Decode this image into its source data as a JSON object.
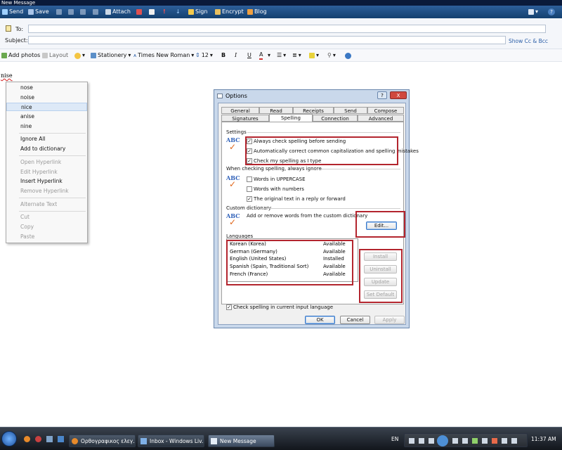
{
  "window": {
    "title": "New Message"
  },
  "toolbar": {
    "send": "Send",
    "save": "Save",
    "attach": "Attach",
    "sign": "Sign",
    "encrypt": "Encrypt",
    "blog": "Blog",
    "help": "?"
  },
  "header": {
    "to_label": "To:",
    "subject_label": "Subject:",
    "show_cc_bcc": "Show Cc & Bcc"
  },
  "format_bar": {
    "add_photos": "Add photos",
    "layout": "Layout",
    "stationery": "Stationery",
    "font": "Times New Roman",
    "size": "12",
    "bold": "B",
    "italic": "I",
    "underline": "U",
    "font_color": "A"
  },
  "body": {
    "misspelled_word": "nise"
  },
  "context_menu": {
    "suggestions": [
      "nose",
      "noise",
      "nice",
      "anise",
      "nine"
    ],
    "ignore_all": "Ignore All",
    "add_to_dictionary": "Add to dictionary",
    "open_hyperlink": "Open Hyperlink",
    "edit_hyperlink": "Edit Hyperlink",
    "insert_hyperlink": "Insert Hyperlink",
    "remove_hyperlink": "Remove Hyperlink",
    "alternate_text": "Alternate Text",
    "cut": "Cut",
    "copy": "Copy",
    "paste": "Paste"
  },
  "dialog": {
    "title": "Options",
    "help": "?",
    "close": "X",
    "tabs_row1": [
      "General",
      "Read",
      "Receipts",
      "Send",
      "Compose"
    ],
    "tabs_row2": [
      "Signatures",
      "Spelling",
      "Connection",
      "Advanced"
    ],
    "settings_label": "Settings",
    "settings": [
      "Always check spelling before sending",
      "Automatically correct common capitalization and spelling mistakes",
      "Check my spelling as I type"
    ],
    "ignore_label": "When checking spelling, always ignore",
    "ignore": [
      "Words in UPPERCASE",
      "Words with numbers",
      "The original text in a reply or forward"
    ],
    "custom_dict_label": "Custom dictionary",
    "custom_dict_text": "Add or remove words from the custom dictionary",
    "edit_button": "Edit...",
    "languages_label": "Languages",
    "languages": [
      {
        "name": "Korean (Korea)",
        "status": "Available"
      },
      {
        "name": "German (Germany)",
        "status": "Available"
      },
      {
        "name": "English (United States)",
        "status": "Installed"
      },
      {
        "name": "Spanish (Spain, Traditional Sort)",
        "status": "Available"
      },
      {
        "name": "French (France)",
        "status": "Available"
      }
    ],
    "install": "Install",
    "uninstall": "Uninstall",
    "update": "Update",
    "set_default": "Set Default",
    "check_input_lang": "Check spelling in current input language",
    "ok": "OK",
    "cancel": "Cancel",
    "apply": "Apply",
    "abc": "ABC",
    "check": "✓"
  },
  "taskbar": {
    "tasks": [
      "Ορθογραφικος ελεγ...",
      "Inbox - Windows Liv...",
      "New Message"
    ],
    "lang": "EN",
    "clock": "11:37 AM"
  }
}
